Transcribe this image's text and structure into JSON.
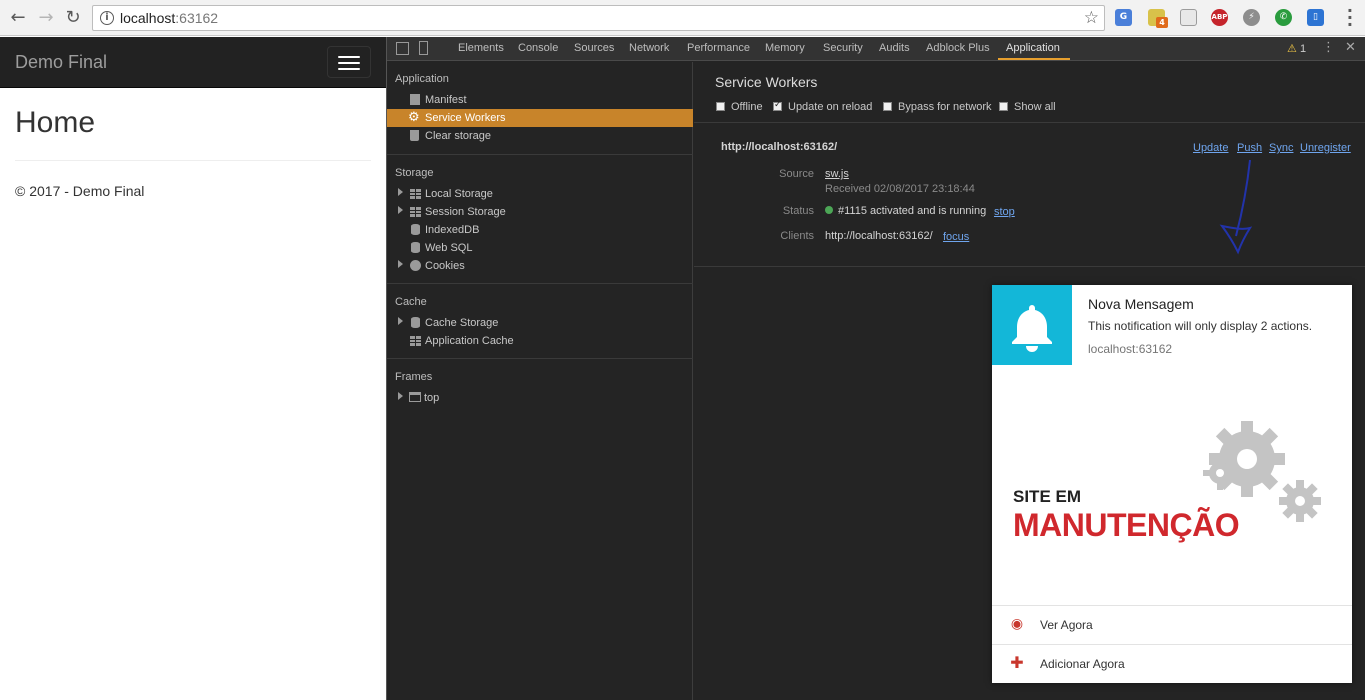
{
  "browser": {
    "url_host": "localhost",
    "url_port": ":63162",
    "ext_badge": "4",
    "ext_abp": "ABP"
  },
  "page": {
    "brand": "Demo Final",
    "heading": "Home",
    "footer": "© 2017 - Demo Final"
  },
  "devtools": {
    "tabs": [
      "Elements",
      "Console",
      "Sources",
      "Network",
      "Performance",
      "Memory",
      "Security",
      "Audits",
      "Adblock Plus",
      "Application"
    ],
    "active_tab": "Application",
    "warning_count": "1",
    "sidebar": {
      "application": {
        "title": "Application",
        "items": [
          "Manifest",
          "Service Workers",
          "Clear storage"
        ]
      },
      "storage": {
        "title": "Storage",
        "items": [
          "Local Storage",
          "Session Storage",
          "IndexedDB",
          "Web SQL",
          "Cookies"
        ]
      },
      "cache": {
        "title": "Cache",
        "items": [
          "Cache Storage",
          "Application Cache"
        ]
      },
      "frames": {
        "title": "Frames",
        "items": [
          "top"
        ]
      }
    },
    "service_workers": {
      "title": "Service Workers",
      "options": {
        "offline": "Offline",
        "update_on_reload": "Update on reload",
        "bypass": "Bypass for network",
        "show_all": "Show all"
      },
      "origin": "http://localhost:63162/",
      "actions": {
        "update": "Update",
        "push": "Push",
        "sync": "Sync",
        "unregister": "Unregister"
      },
      "source_key": "Source",
      "source_value": "sw.js",
      "received": "Received 02/08/2017 23:18:44",
      "status_key": "Status",
      "status_value": "#1115 activated and is running",
      "stop": "stop",
      "clients_key": "Clients",
      "clients_value": "http://localhost:63162/",
      "focus": "focus"
    }
  },
  "notification": {
    "title": "Nova Mensagem",
    "body": "This notification will only display 2 actions.",
    "origin": "localhost:63162",
    "image_text_top": "SITE EM",
    "image_text_main": "MANUTENÇÃO",
    "actions": [
      "Ver Agora",
      "Adicionar Agora"
    ]
  },
  "colors": {
    "accent": "#c8842a",
    "link": "#6fa5ee",
    "notif_icon_bg": "#13b7d8",
    "maintenance_red": "#d0282d"
  }
}
